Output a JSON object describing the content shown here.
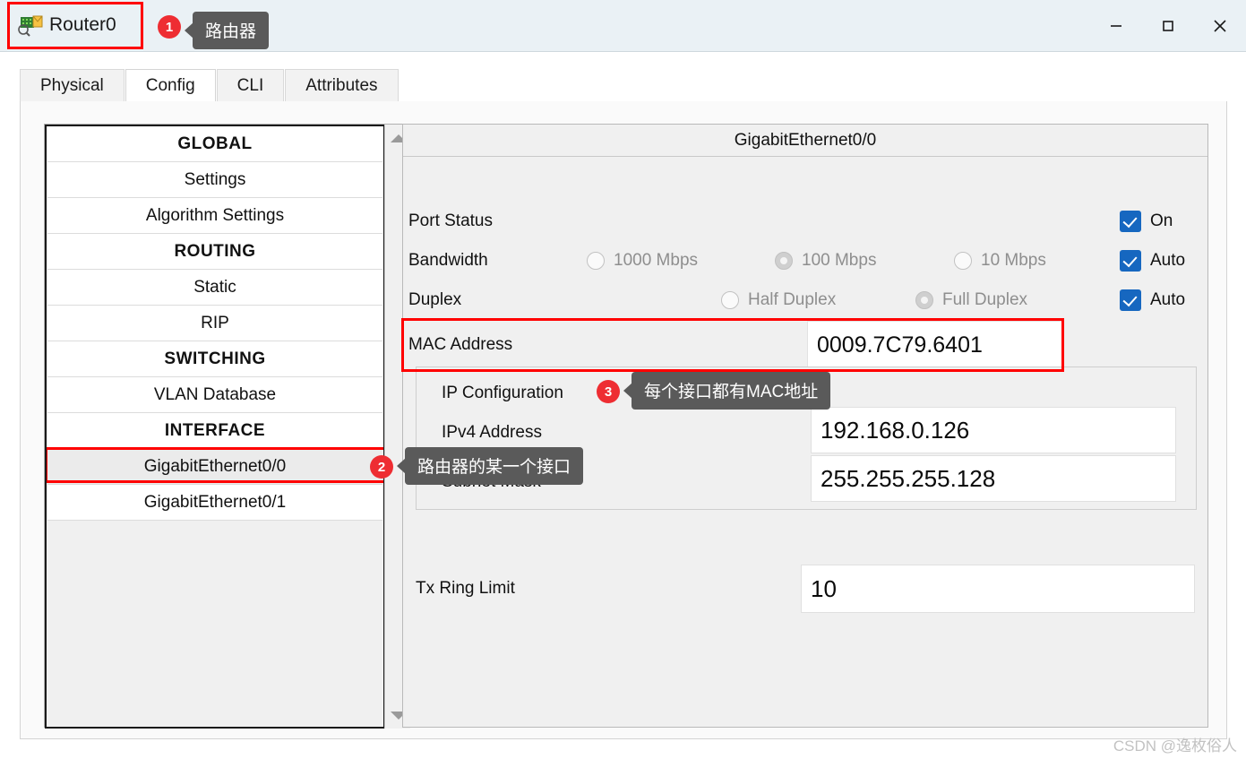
{
  "window": {
    "title": "Router0",
    "icon": "router-icon",
    "minimize_label": "—",
    "maximize_label": "□",
    "close_label": "✕"
  },
  "tabs": [
    {
      "label": "Physical",
      "active": false
    },
    {
      "label": "Config",
      "active": true
    },
    {
      "label": "CLI",
      "active": false
    },
    {
      "label": "Attributes",
      "active": false
    }
  ],
  "sidebar": {
    "items": [
      {
        "label": "GLOBAL",
        "type": "header"
      },
      {
        "label": "Settings",
        "type": "item"
      },
      {
        "label": "Algorithm Settings",
        "type": "item"
      },
      {
        "label": "ROUTING",
        "type": "header"
      },
      {
        "label": "Static",
        "type": "item"
      },
      {
        "label": "RIP",
        "type": "item"
      },
      {
        "label": "SWITCHING",
        "type": "header"
      },
      {
        "label": "VLAN Database",
        "type": "item"
      },
      {
        "label": "INTERFACE",
        "type": "header"
      },
      {
        "label": "GigabitEthernet0/0",
        "type": "item",
        "selected": true
      },
      {
        "label": "GigabitEthernet0/1",
        "type": "item"
      }
    ]
  },
  "interface_panel": {
    "header": "GigabitEthernet0/0",
    "port_status": {
      "label": "Port Status",
      "checkbox_label": "On",
      "checked": true
    },
    "bandwidth": {
      "label": "Bandwidth",
      "options": [
        {
          "label": "1000 Mbps",
          "selected": false
        },
        {
          "label": "100 Mbps",
          "selected": true
        },
        {
          "label": "10 Mbps",
          "selected": false
        }
      ],
      "auto_label": "Auto",
      "auto_checked": true
    },
    "duplex": {
      "label": "Duplex",
      "options": [
        {
          "label": "Half Duplex",
          "selected": false
        },
        {
          "label": "Full Duplex",
          "selected": true
        }
      ],
      "auto_label": "Auto",
      "auto_checked": true
    },
    "mac_address": {
      "label": "MAC Address",
      "value": "0009.7C79.6401"
    },
    "ip_configuration": {
      "title": "IP Configuration",
      "ipv4_label": "IPv4 Address",
      "ipv4_value": "192.168.0.126",
      "subnet_label": "Subnet Mask",
      "subnet_value": "255.255.255.128"
    },
    "tx_ring_limit": {
      "label": "Tx Ring Limit",
      "value": "10"
    }
  },
  "annotations": [
    {
      "number": "1",
      "text": "路由器"
    },
    {
      "number": "2",
      "text": "路由器的某一个接口"
    },
    {
      "number": "3",
      "text": "每个接口都有MAC地址"
    }
  ],
  "watermark": "CSDN @逸枚俗人",
  "colors": {
    "accent_blue": "#1667c0",
    "highlight_red": "#ff0000",
    "badge_red": "#ee2d32",
    "tooltip_gray": "#5a5a5a"
  }
}
